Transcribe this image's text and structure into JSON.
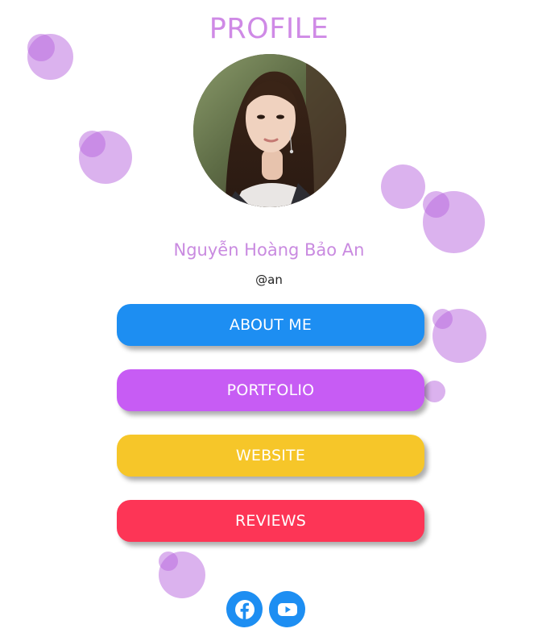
{
  "page": {
    "title": "PROFILE"
  },
  "profile": {
    "name": "Nguyễn Hoàng Bảo An",
    "handle": "@an"
  },
  "links": [
    {
      "label": "ABOUT ME",
      "color": "#1d8ef2"
    },
    {
      "label": "PORTFOLIO",
      "color": "#c75cf4"
    },
    {
      "label": "WEBSITE",
      "color": "#f6c629"
    },
    {
      "label": "REVIEWS",
      "color": "#fd3556"
    }
  ],
  "social": [
    {
      "icon": "facebook-icon",
      "color": "#1d8ef2"
    },
    {
      "icon": "youtube-icon",
      "color": "#1d8ef2"
    }
  ],
  "theme": {
    "accent": "#cf8ae6",
    "bubble": "#b866de"
  }
}
